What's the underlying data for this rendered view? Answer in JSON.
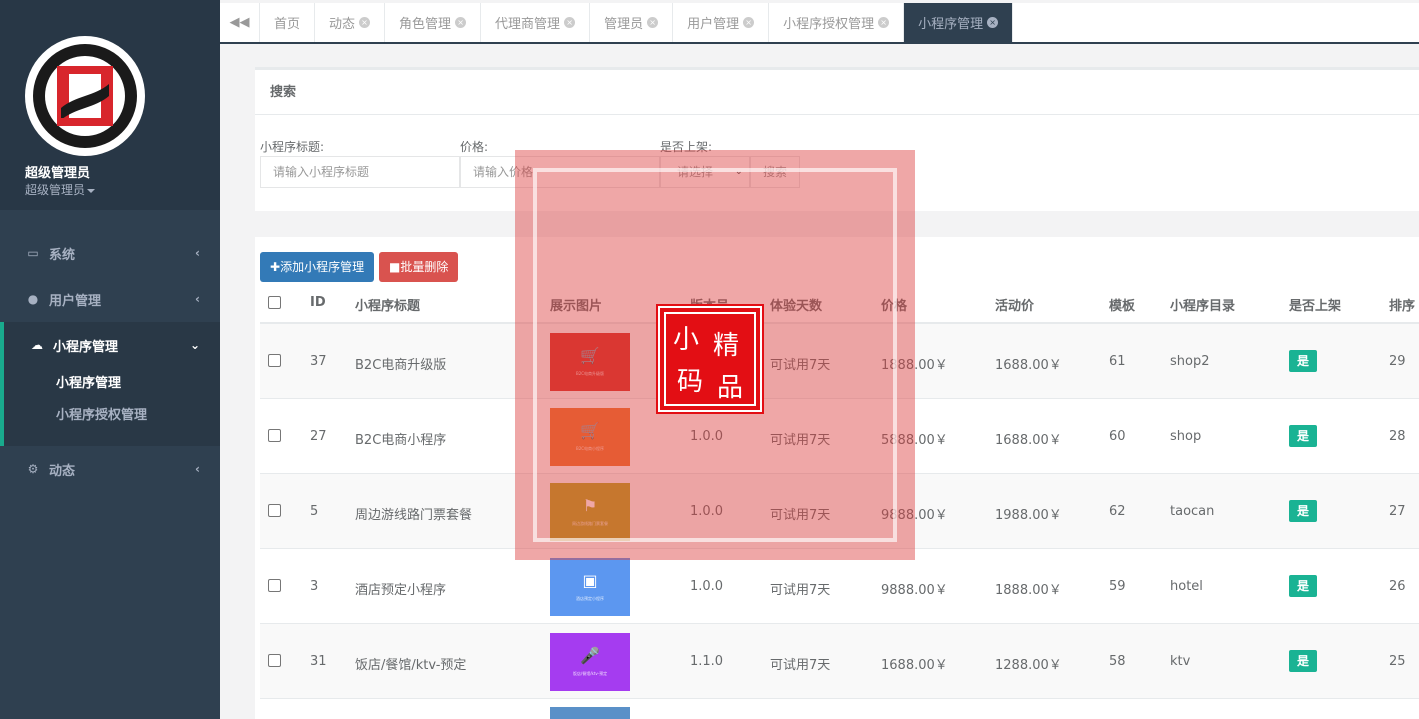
{
  "sidebar": {
    "profile_name": "超级管理员",
    "profile_role": "超级管理员",
    "nav": [
      {
        "label": "系统",
        "icon": "monitor-icon"
      },
      {
        "label": "用户管理",
        "icon": "user-icon"
      },
      {
        "label": "小程序管理",
        "icon": "wechat-icon"
      },
      {
        "label": "动态",
        "icon": "gears-icon"
      }
    ],
    "sub_items": [
      "小程序管理",
      "小程序授权管理"
    ]
  },
  "tabs": [
    "首页",
    "动态",
    "角色管理",
    "代理商管理",
    "管理员",
    "用户管理",
    "小程序授权管理",
    "小程序管理"
  ],
  "active_tab": "小程序管理",
  "search": {
    "panel_title": "搜索",
    "title_label": "小程序标题:",
    "title_placeholder": "请输入小程序标题",
    "price_label": "价格:",
    "price_placeholder": "请输入价格",
    "shelf_label": "是否上架:",
    "shelf_value": "请选择",
    "button": "搜索"
  },
  "toolbar": {
    "add_label": "添加小程序管理",
    "delete_label": "批量删除"
  },
  "table": {
    "headers": [
      "ID",
      "小程序标题",
      "展示图片",
      "版本号",
      "体验天数",
      "价格",
      "活动价",
      "模板",
      "小程序目录",
      "是否上架",
      "排序"
    ],
    "rows": [
      {
        "id": "37",
        "title": "B2C电商升级版",
        "color": "#d9342b",
        "icon": "cart-icon",
        "version": "",
        "days": "可试用7天",
        "price": "1888.00￥",
        "sale": "1688.00￥",
        "template": "61",
        "dir": "shop2",
        "shelf": "是",
        "sort": "29"
      },
      {
        "id": "27",
        "title": "B2C电商小程序",
        "color": "#ef7730",
        "icon": "cart-icon",
        "version": "1.0.0",
        "days": "可试用7天",
        "price": "5888.00￥",
        "sale": "1688.00￥",
        "template": "60",
        "dir": "shop",
        "shelf": "是",
        "sort": "28"
      },
      {
        "id": "5",
        "title": "周边游线路门票套餐",
        "color": "#b5a823",
        "icon": "signpost-icon",
        "version": "1.0.0",
        "days": "可试用7天",
        "price": "9888.00￥",
        "sale": "1988.00￥",
        "template": "62",
        "dir": "taocan",
        "shelf": "是",
        "sort": "27"
      },
      {
        "id": "3",
        "title": "酒店预定小程序",
        "color": "#5c97f0",
        "icon": "building-icon",
        "version": "1.0.0",
        "days": "可试用7天",
        "price": "9888.00￥",
        "sale": "1888.00￥",
        "template": "59",
        "dir": "hotel",
        "shelf": "是",
        "sort": "26"
      },
      {
        "id": "31",
        "title": "饭店/餐馆/ktv-预定",
        "color": "#a53cf0",
        "icon": "microphone-icon",
        "version": "1.1.0",
        "days": "可试用7天",
        "price": "1688.00￥",
        "sale": "1288.00￥",
        "template": "58",
        "dir": "ktv",
        "shelf": "是",
        "sort": "25"
      }
    ]
  },
  "watermark_text": "小精品码"
}
